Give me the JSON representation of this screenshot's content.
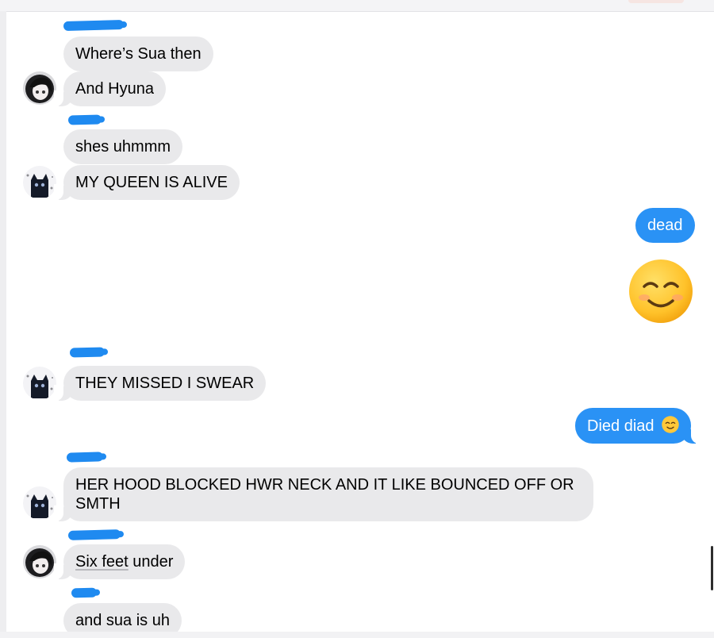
{
  "conversation": {
    "messages": [
      {
        "sender": "them",
        "text": "Where’s Sua then"
      },
      {
        "sender": "them",
        "text": "And Hyuna",
        "avatar": "anime-avatar"
      },
      {
        "sender": "them",
        "text": "shes uhmmm"
      },
      {
        "sender": "them",
        "text": "MY QUEEN IS ALIVE",
        "avatar": "cat-avatar"
      },
      {
        "sender": "me",
        "text": "dead"
      },
      {
        "sender": "me",
        "emoji": "smiling-face-with-smiling-eyes"
      },
      {
        "sender": "them",
        "text": "THEY MISSED I SWEAR",
        "avatar": "cat-avatar"
      },
      {
        "sender": "me",
        "text": "Died diad",
        "emoji": "smiling-face-with-smiling-eyes"
      },
      {
        "sender": "them",
        "text": "HER HOOD BLOCKED HWR NECK AND IT LIKE BOUNCED OFF OR SMTH",
        "avatar": "cat-avatar"
      },
      {
        "sender": "them",
        "text_underlined": "Six feet",
        "text_rest": " under",
        "avatar": "anime-avatar"
      },
      {
        "sender": "them",
        "text": "and sua is uh"
      }
    ]
  },
  "colors": {
    "received_bubble": "#e9e9eb",
    "sent_bubble": "#2a92f5",
    "redaction": "#1f8af0"
  }
}
